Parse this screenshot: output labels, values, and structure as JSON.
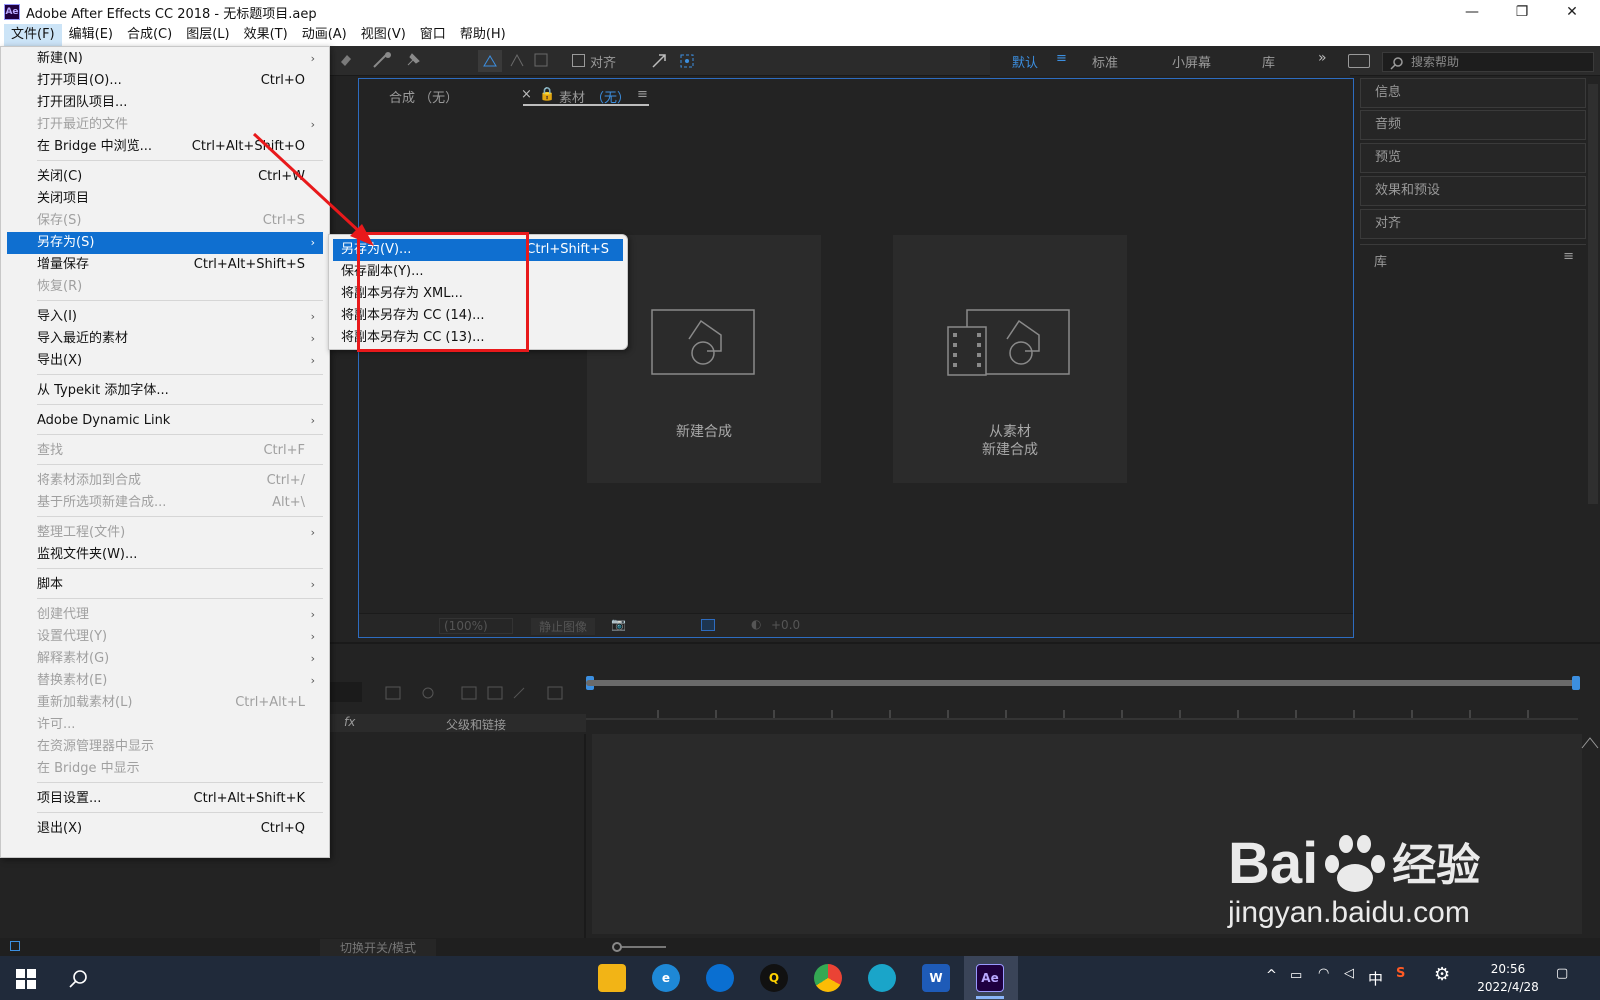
{
  "window": {
    "title": "Adobe After Effects CC 2018 - 无标题项目.aep",
    "logo_text": "Ae"
  },
  "menubar": [
    "文件(F)",
    "编辑(E)",
    "合成(C)",
    "图层(L)",
    "效果(T)",
    "动画(A)",
    "视图(V)",
    "窗口",
    "帮助(H)"
  ],
  "toolbar": {
    "align_label": "对齐",
    "workspaces": [
      "默认",
      "标准",
      "小屏幕",
      "库"
    ],
    "search_placeholder": "搜索帮助"
  },
  "viewer": {
    "tab_comp": "合成 （无）",
    "tab_footage_prefix": "素材",
    "tab_footage_suffix": "（无）",
    "card_new_comp": "新建合成",
    "card_from_footage_line1": "从素材",
    "card_from_footage_line2": "新建合成",
    "zoom": "(100%)",
    "still_image": "静止图像",
    "exposure": "+0.0"
  },
  "right_panels": [
    "信息",
    "音频",
    "预览",
    "效果和预设",
    "对齐",
    "库"
  ],
  "timeline": {
    "parent_link": "父级和链接",
    "toggle_switches": "切换开关/模式"
  },
  "file_menu": {
    "items": [
      {
        "label": "新建(N)",
        "shortcut": "",
        "submenu": true,
        "disabled": false
      },
      {
        "label": "打开项目(O)...",
        "shortcut": "Ctrl+O",
        "submenu": false,
        "disabled": false
      },
      {
        "label": "打开团队项目...",
        "shortcut": "",
        "submenu": false,
        "disabled": false
      },
      {
        "label": "打开最近的文件",
        "shortcut": "",
        "submenu": true,
        "disabled": true
      },
      {
        "label": "在 Bridge 中浏览...",
        "shortcut": "Ctrl+Alt+Shift+O",
        "submenu": false,
        "disabled": false
      },
      {
        "label": "关闭(C)",
        "shortcut": "Ctrl+W",
        "submenu": false,
        "disabled": false
      },
      {
        "label": "关闭项目",
        "shortcut": "",
        "submenu": false,
        "disabled": false
      },
      {
        "label": "保存(S)",
        "shortcut": "Ctrl+S",
        "submenu": false,
        "disabled": true
      },
      {
        "label": "另存为(S)",
        "shortcut": "",
        "submenu": true,
        "disabled": false,
        "selected": true
      },
      {
        "label": "增量保存",
        "shortcut": "Ctrl+Alt+Shift+S",
        "submenu": false,
        "disabled": false
      },
      {
        "label": "恢复(R)",
        "shortcut": "",
        "submenu": false,
        "disabled": true
      },
      {
        "label": "导入(I)",
        "shortcut": "",
        "submenu": true,
        "disabled": false
      },
      {
        "label": "导入最近的素材",
        "shortcut": "",
        "submenu": true,
        "disabled": false
      },
      {
        "label": "导出(X)",
        "shortcut": "",
        "submenu": true,
        "disabled": false
      },
      {
        "label": "从 Typekit 添加字体...",
        "shortcut": "",
        "submenu": false,
        "disabled": false
      },
      {
        "label": "Adobe Dynamic Link",
        "shortcut": "",
        "submenu": true,
        "disabled": false
      },
      {
        "label": "查找",
        "shortcut": "Ctrl+F",
        "submenu": false,
        "disabled": true
      },
      {
        "label": "将素材添加到合成",
        "shortcut": "Ctrl+/",
        "submenu": false,
        "disabled": true
      },
      {
        "label": "基于所选项新建合成...",
        "shortcut": "Alt+\\",
        "submenu": false,
        "disabled": true
      },
      {
        "label": "整理工程(文件)",
        "shortcut": "",
        "submenu": true,
        "disabled": true
      },
      {
        "label": "监视文件夹(W)...",
        "shortcut": "",
        "submenu": false,
        "disabled": false
      },
      {
        "label": "脚本",
        "shortcut": "",
        "submenu": true,
        "disabled": false
      },
      {
        "label": "创建代理",
        "shortcut": "",
        "submenu": true,
        "disabled": true
      },
      {
        "label": "设置代理(Y)",
        "shortcut": "",
        "submenu": true,
        "disabled": true
      },
      {
        "label": "解释素材(G)",
        "shortcut": "",
        "submenu": true,
        "disabled": true
      },
      {
        "label": "替换素材(E)",
        "shortcut": "",
        "submenu": true,
        "disabled": true
      },
      {
        "label": "重新加载素材(L)",
        "shortcut": "Ctrl+Alt+L",
        "submenu": false,
        "disabled": true
      },
      {
        "label": "许可...",
        "shortcut": "",
        "submenu": false,
        "disabled": true
      },
      {
        "label": "在资源管理器中显示",
        "shortcut": "",
        "submenu": false,
        "disabled": true
      },
      {
        "label": "在 Bridge 中显示",
        "shortcut": "",
        "submenu": false,
        "disabled": true
      },
      {
        "label": "项目设置...",
        "shortcut": "Ctrl+Alt+Shift+K",
        "submenu": false,
        "disabled": false
      },
      {
        "label": "退出(X)",
        "shortcut": "Ctrl+Q",
        "submenu": false,
        "disabled": false
      }
    ]
  },
  "save_as_submenu": [
    {
      "label": "另存为(V)...",
      "shortcut": "Ctrl+Shift+S",
      "selected": true
    },
    {
      "label": "保存副本(Y)...",
      "shortcut": ""
    },
    {
      "label": "将副本另存为 XML...",
      "shortcut": ""
    },
    {
      "label": "将副本另存为 CC (14)...",
      "shortcut": ""
    },
    {
      "label": "将副本另存为 CC (13)...",
      "shortcut": ""
    }
  ],
  "taskbar": {
    "time": "20:56",
    "date": "2022/4/28",
    "ime": "中"
  },
  "watermark": {
    "brand": "Bai",
    "brand2": "经验",
    "url": "jingyan.baidu.com"
  },
  "colors": {
    "menu_selection": "#0f6fd0",
    "highlight_box": "#e8191b",
    "accent_blue": "#3c8fe0"
  }
}
